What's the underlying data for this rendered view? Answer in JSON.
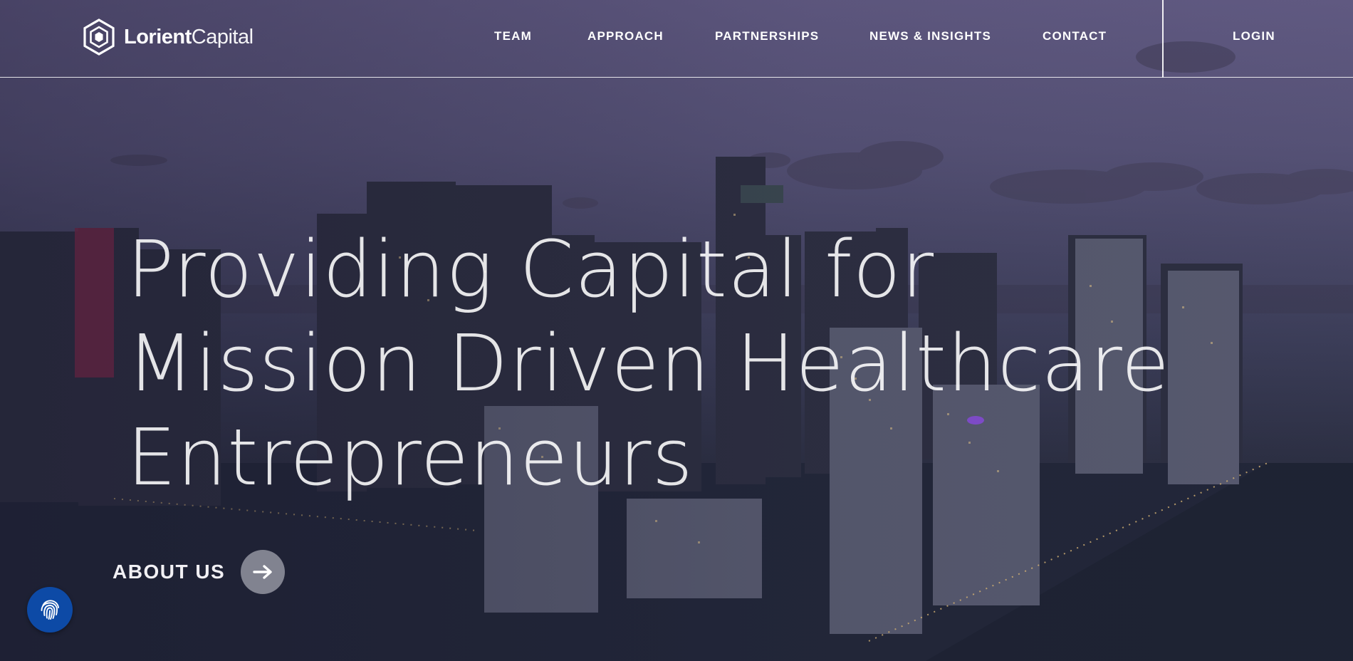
{
  "brand": {
    "name_bold": "Lorient",
    "name_light": "Capital",
    "logo_icon": "hexagon-logo-icon"
  },
  "nav": {
    "items": [
      {
        "label": "TEAM"
      },
      {
        "label": "APPROACH"
      },
      {
        "label": "PARTNERSHIPS"
      },
      {
        "label": "NEWS & INSIGHTS"
      },
      {
        "label": "CONTACT"
      }
    ],
    "login_label": "LOGIN"
  },
  "hero": {
    "headline_lines": [
      "Providing Capital for",
      "Mission Driven Healthcare",
      "Entrepreneurs"
    ],
    "cta_label": "ABOUT US",
    "cta_icon": "arrow-right-icon",
    "background": "aerial-city-skyline-dusk"
  },
  "widgets": {
    "accessibility_icon": "fingerprint-icon",
    "accessibility_color": "#0d4aa6"
  },
  "colors": {
    "text": "#ffffff",
    "sky_top": "#645d86",
    "water": "#1a1e2c"
  }
}
